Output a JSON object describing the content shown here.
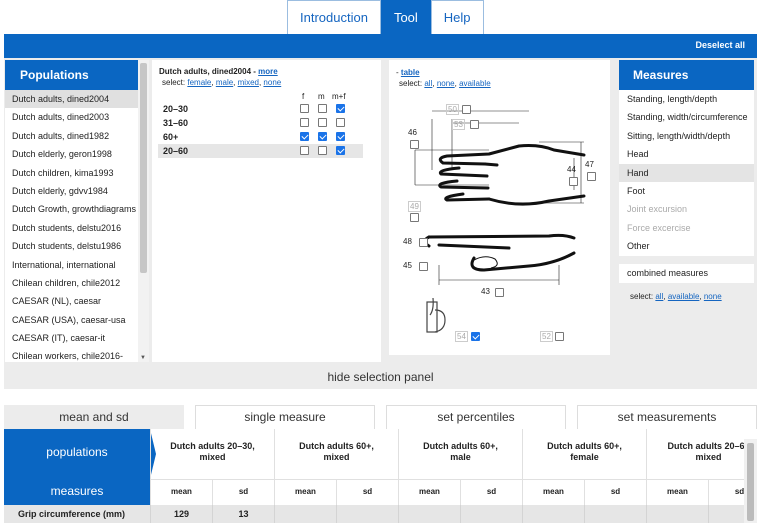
{
  "top_tabs": [
    {
      "label": "Introduction",
      "active": false
    },
    {
      "label": "Tool",
      "active": true
    },
    {
      "label": "Help",
      "active": false
    }
  ],
  "deselect_all": "Deselect all",
  "populations": {
    "title": "Populations",
    "items": [
      {
        "label": "Dutch adults, dined2004",
        "selected": true
      },
      {
        "label": "Dutch adults, dined2003"
      },
      {
        "label": "Dutch adults, dined1982"
      },
      {
        "label": "Dutch elderly, geron1998"
      },
      {
        "label": "Dutch children, kima1993"
      },
      {
        "label": "Dutch elderly, gdvv1984"
      },
      {
        "label": "Dutch Growth, growthdiagrams"
      },
      {
        "label": "Dutch students, delstu2016"
      },
      {
        "label": "Dutch students, delstu1986"
      },
      {
        "label": "International, international"
      },
      {
        "label": "Chilean children, chile2012"
      },
      {
        "label": "CAESAR (NL), caesar"
      },
      {
        "label": "CAESAR (USA), caesar-usa"
      },
      {
        "label": "CAESAR (IT), caesar-it"
      },
      {
        "label": "Chilean workers, chile2016-"
      }
    ]
  },
  "age_groups": {
    "title": "Dutch adults, dined2004 -",
    "more": "more",
    "select_prefix": "select:",
    "select_links": [
      "female",
      "male",
      "mixed",
      "none"
    ],
    "columns": [
      "f",
      "m",
      "m+f"
    ],
    "rows": [
      {
        "label": "20–30",
        "f": false,
        "m": false,
        "mf": true
      },
      {
        "label": "31–60",
        "f": false,
        "m": false,
        "mf": false
      },
      {
        "label": "60+",
        "f": true,
        "m": true,
        "mf": true
      },
      {
        "label": "20–60",
        "f": false,
        "m": false,
        "mf": true
      }
    ]
  },
  "hand": {
    "dash": "-",
    "table_link": "table",
    "select_prefix": "select:",
    "select_links": [
      "all",
      "none",
      "available"
    ],
    "numbers": [
      "50",
      "53",
      "46",
      "44",
      "47",
      "49",
      "48",
      "45",
      "43",
      "54",
      "52"
    ],
    "checked": {
      "54": true
    }
  },
  "measures": {
    "title": "Measures",
    "items": [
      {
        "label": "Standing, length/depth"
      },
      {
        "label": "Standing, width/circumference"
      },
      {
        "label": "Sitting, length/width/depth"
      },
      {
        "label": "Head"
      },
      {
        "label": "Hand",
        "selected": true
      },
      {
        "label": "Foot"
      },
      {
        "label": "Joint excursion",
        "disabled": true
      },
      {
        "label": "Force excercise",
        "disabled": true
      },
      {
        "label": "Other"
      }
    ],
    "combined": "combined measures",
    "select_prefix": "select:",
    "select_links": [
      "all",
      "available",
      "none"
    ]
  },
  "hide_panel": "hide selection panel",
  "view_tabs": [
    {
      "label": "mean and sd",
      "active": true
    },
    {
      "label": "single measure"
    },
    {
      "label": "set percentiles"
    },
    {
      "label": "set measurements"
    }
  ],
  "table": {
    "populations_header": "populations",
    "measures_header": "measures",
    "groups": [
      {
        "line1": "Dutch adults 20–30,",
        "line2": "mixed"
      },
      {
        "line1": "Dutch adults 60+,",
        "line2": "mixed"
      },
      {
        "line1": "Dutch adults 60+,",
        "line2": "male"
      },
      {
        "line1": "Dutch adults 60+,",
        "line2": "female"
      },
      {
        "line1": "Dutch adults 20–60",
        "line2": "mixed"
      }
    ],
    "sub_mean": "mean",
    "sub_sd": "sd",
    "rows": [
      {
        "label": "Grip circumference (mm)",
        "values": [
          "129",
          "13",
          "",
          "",
          "",
          "",
          "",
          "",
          "",
          ""
        ]
      }
    ]
  }
}
